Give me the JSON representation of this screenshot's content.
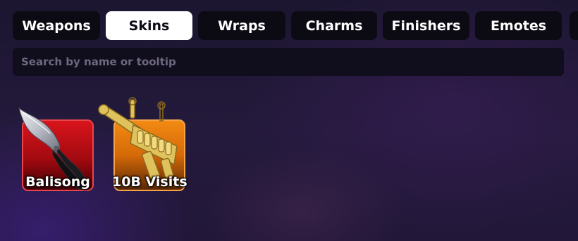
{
  "tabs": [
    {
      "label": "Weapons",
      "active": false
    },
    {
      "label": "Skins",
      "active": true
    },
    {
      "label": "Wraps",
      "active": false
    },
    {
      "label": "Charms",
      "active": false
    },
    {
      "label": "Finishers",
      "active": false
    },
    {
      "label": "Emotes",
      "active": false
    }
  ],
  "search": {
    "placeholder": "Search by name or tooltip",
    "value": ""
  },
  "items": [
    {
      "label": "Balisong",
      "rarity_color": "#d9141c",
      "icon": "balisong-knife-icon"
    },
    {
      "label": "10B Visits",
      "rarity_color": "#f28a13",
      "icon": "golden-10b-gun-icon"
    }
  ],
  "colors": {
    "tab_bg": "#0c0b14",
    "tab_active_bg": "#ffffff",
    "search_bg": "#100d1c",
    "page_bg": "#1c1630"
  }
}
